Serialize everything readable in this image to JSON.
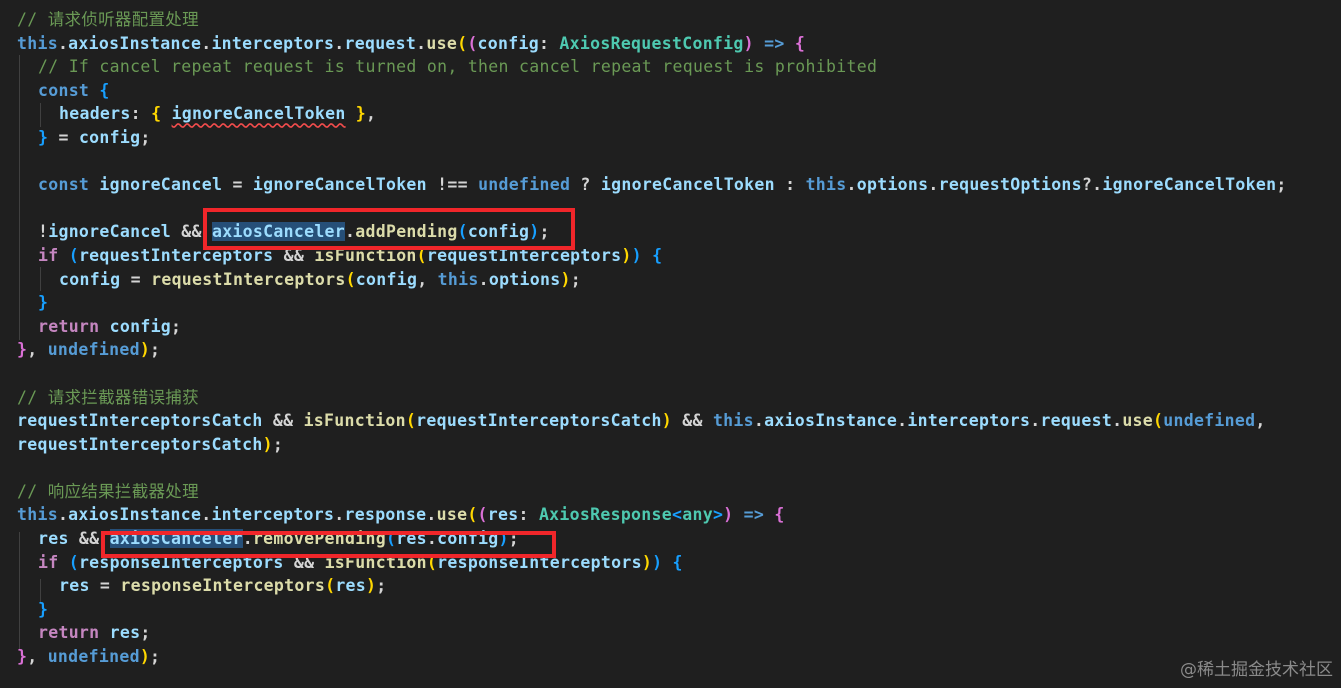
{
  "code": {
    "language": "typescript",
    "lines": [
      "// 请求侦听器配置处理",
      "this.axiosInstance.interceptors.request.use((config: AxiosRequestConfig) => {",
      "  // If cancel repeat request is turned on, then cancel repeat request is prohibited",
      "  const {",
      "    headers: { ignoreCancelToken },",
      "  } = config;",
      "",
      "  const ignoreCancel = ignoreCancelToken !== undefined ? ignoreCancelToken : this.options.requestOptions?.ignoreCancelToken;",
      "",
      "  !ignoreCancel && axiosCanceler.addPending(config);",
      "  if (requestInterceptors && isFunction(requestInterceptors)) {",
      "    config = requestInterceptors(config, this.options);",
      "  }",
      "  return config;",
      "}, undefined);",
      "",
      "// 请求拦截器错误捕获",
      "requestInterceptorsCatch && isFunction(requestInterceptorsCatch) && this.axiosInstance.interceptors.request.use(undefined,",
      "requestInterceptorsCatch);",
      "",
      "// 响应结果拦截器处理",
      "this.axiosInstance.interceptors.response.use((res: AxiosResponse<any>) => {",
      "  res && axiosCanceler.removePending(res.config);",
      "  if (responseInterceptors && isFunction(responseInterceptors)) {",
      "    res = responseInterceptors(res);",
      "  }",
      "  return res;",
      "}, undefined);"
    ],
    "highlighted_symbol": "axiosCanceler",
    "squiggle_symbol": "ignoreCancelToken"
  },
  "watermark": "@稀土掘金技术社区",
  "colors": {
    "background": "#1f1f1f",
    "comment": "#6a9955",
    "keyword": "#569cd6",
    "control": "#c586c0",
    "variable": "#9cdcfe",
    "function": "#dcdcaa",
    "type": "#4ec9b0",
    "annotation_box": "#f0262a"
  }
}
